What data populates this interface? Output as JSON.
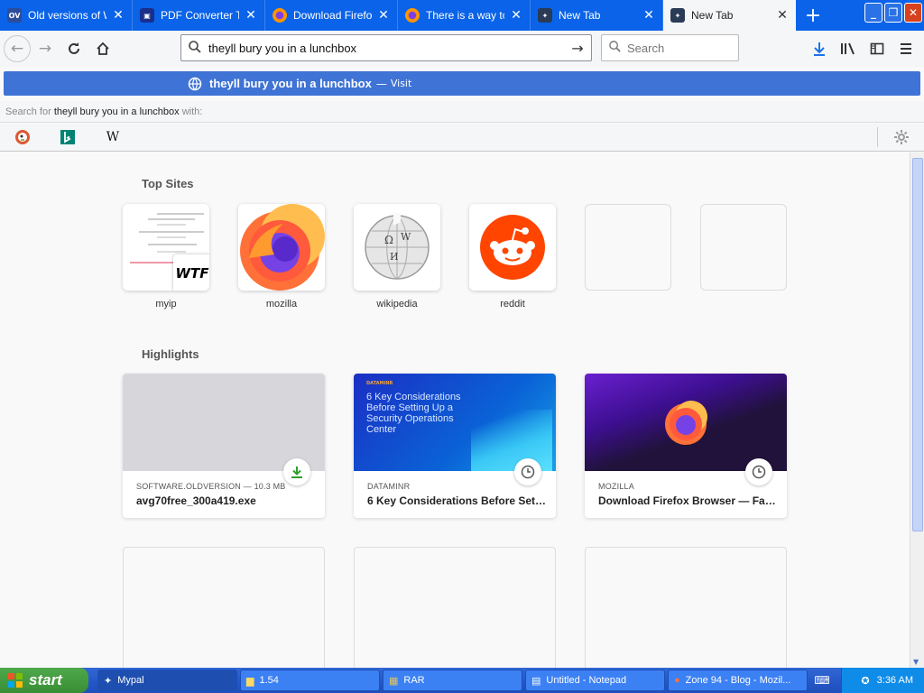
{
  "tabs": [
    {
      "label": "Old versions of W",
      "favicon": "OV",
      "color": "#2b4c9b"
    },
    {
      "label": "PDF Converter To",
      "favicon": "",
      "color": "#1a2e8c"
    },
    {
      "label": "Download Firefox",
      "favicon": "",
      "color": "#e66000"
    },
    {
      "label": "There is a way to",
      "favicon": "",
      "color": "#e66000"
    },
    {
      "label": "New Tab",
      "favicon": "",
      "color": "#2a3b55"
    },
    {
      "label": "New Tab",
      "favicon": "",
      "color": "#2a3b55"
    }
  ],
  "navbar": {
    "url_value": "theyll bury you in a lunchbox",
    "search_placeholder": "Search"
  },
  "suggestion": {
    "text": "theyll bury you in a lunchbox",
    "separator": "—",
    "visit_label": "Visit"
  },
  "search_with": {
    "prefix": "Search for",
    "query": "theyll bury you in a lunchbox",
    "suffix": "with:"
  },
  "engines": [
    {
      "name": "duckduckgo-icon"
    },
    {
      "name": "bing-icon"
    },
    {
      "name": "wikipedia-icon",
      "glyph": "W"
    }
  ],
  "top_sites": {
    "title": "Top Sites",
    "items": [
      {
        "label": "myip",
        "overlay": "WTF"
      },
      {
        "label": "mozilla"
      },
      {
        "label": "wikipedia"
      },
      {
        "label": "reddit"
      },
      {
        "label": ""
      },
      {
        "label": ""
      }
    ]
  },
  "highlights": {
    "title": "Highlights",
    "cards": [
      {
        "source": "SOFTWARE.OLDVERSION — 10.3 MB",
        "title": "avg70free_300a419.exe",
        "badge": "download-icon"
      },
      {
        "source": "DATAMINR",
        "title": "6 Key Considerations Before Set…",
        "badge": "clock-icon",
        "thumb_brand": "DATAMINR",
        "thumb_text": "6 Key Considerations Before Setting Up a Security Operations Center"
      },
      {
        "source": "MOZILLA",
        "title": "Download Firefox Browser — Fa…",
        "badge": "clock-icon"
      }
    ]
  },
  "taskbar": {
    "start_label": "start",
    "tasks": [
      "Mypal",
      "1.54",
      "RAR",
      "Untitled - Notepad",
      "Zone 94 - Blog - Mozil..."
    ],
    "clock": "3:36 AM"
  },
  "colors": {
    "tabstrip": "#0a63e8",
    "suggestion": "#3f73d5",
    "accent_green": "#2f9e2f"
  }
}
